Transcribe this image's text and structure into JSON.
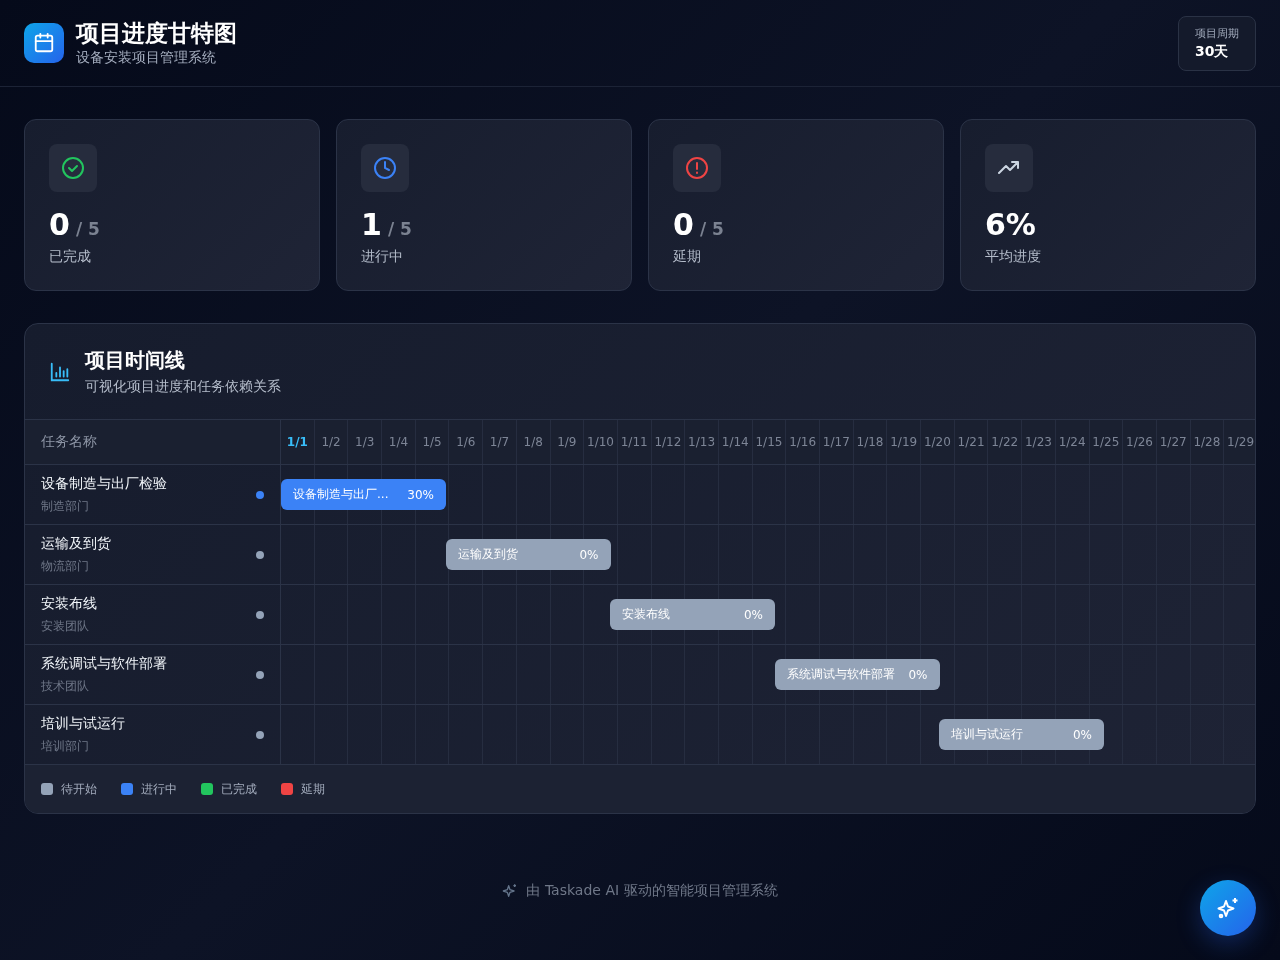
{
  "header": {
    "title": "项目进度甘特图",
    "subtitle": "设备安装项目管理系统",
    "period_label": "项目周期",
    "period_value": "30天"
  },
  "stats": [
    {
      "kind": "done",
      "value": "0",
      "total": "/ 5",
      "label": "已完成"
    },
    {
      "kind": "progress",
      "value": "1",
      "total": "/ 5",
      "label": "进行中"
    },
    {
      "kind": "delayed",
      "value": "0",
      "total": "/ 5",
      "label": "延期"
    },
    {
      "kind": "average",
      "value": "6%",
      "label": "平均进度"
    }
  ],
  "timeline": {
    "title": "项目时间线",
    "subtitle": "可视化项目进度和任务依赖关系",
    "column_header": "任务名称",
    "dates": [
      {
        "label": "1/1",
        "today": true
      },
      {
        "label": "1/2",
        "today": false
      },
      {
        "label": "1/3",
        "today": false
      },
      {
        "label": "1/4",
        "today": false
      },
      {
        "label": "1/5",
        "today": false
      },
      {
        "label": "1/6",
        "today": false
      },
      {
        "label": "1/7",
        "today": false
      },
      {
        "label": "1/8",
        "today": false
      },
      {
        "label": "1/9",
        "today": false
      },
      {
        "label": "1/10",
        "today": false
      },
      {
        "label": "1/11",
        "today": false
      },
      {
        "label": "1/12",
        "today": false
      },
      {
        "label": "1/13",
        "today": false
      },
      {
        "label": "1/14",
        "today": false
      },
      {
        "label": "1/15",
        "today": false
      },
      {
        "label": "1/16",
        "today": false
      },
      {
        "label": "1/17",
        "today": false
      },
      {
        "label": "1/18",
        "today": false
      },
      {
        "label": "1/19",
        "today": false
      },
      {
        "label": "1/20",
        "today": false
      },
      {
        "label": "1/21",
        "today": false
      },
      {
        "label": "1/22",
        "today": false
      },
      {
        "label": "1/23",
        "today": false
      },
      {
        "label": "1/24",
        "today": false
      },
      {
        "label": "1/25",
        "today": false
      },
      {
        "label": "1/26",
        "today": false
      },
      {
        "label": "1/27",
        "today": false
      },
      {
        "label": "1/28",
        "today": false
      },
      {
        "label": "1/29",
        "today": false
      }
    ],
    "tasks": [
      {
        "name": "设备制造与出厂检验",
        "team": "制造部门",
        "color": "#3b82f6",
        "bar_label": "设备制造与出厂...",
        "percent": "30%"
      },
      {
        "name": "运输及到货",
        "team": "物流部门",
        "color": "#94a3b8",
        "bar_label": "运输及到货",
        "percent": "0%"
      },
      {
        "name": "安装布线",
        "team": "安装团队",
        "color": "#94a3b8",
        "bar_label": "安装布线",
        "percent": "0%"
      },
      {
        "name": "系统调试与软件部署",
        "team": "技术团队",
        "color": "#94a3b8",
        "bar_label": "系统调试与软件部署",
        "percent": "0%"
      },
      {
        "name": "培训与试运行",
        "team": "培训部门",
        "color": "#94a3b8",
        "bar_label": "培训与试运行",
        "percent": "0%"
      }
    ],
    "legend": [
      {
        "label": "待开始",
        "color": "#94a3b8"
      },
      {
        "label": "进行中",
        "color": "#3b82f6"
      },
      {
        "label": "已完成",
        "color": "#22c55e"
      },
      {
        "label": "延期",
        "color": "#ef4444"
      }
    ]
  },
  "footer": {
    "text": "由 Taskade AI 驱动的智能项目管理系统"
  }
}
